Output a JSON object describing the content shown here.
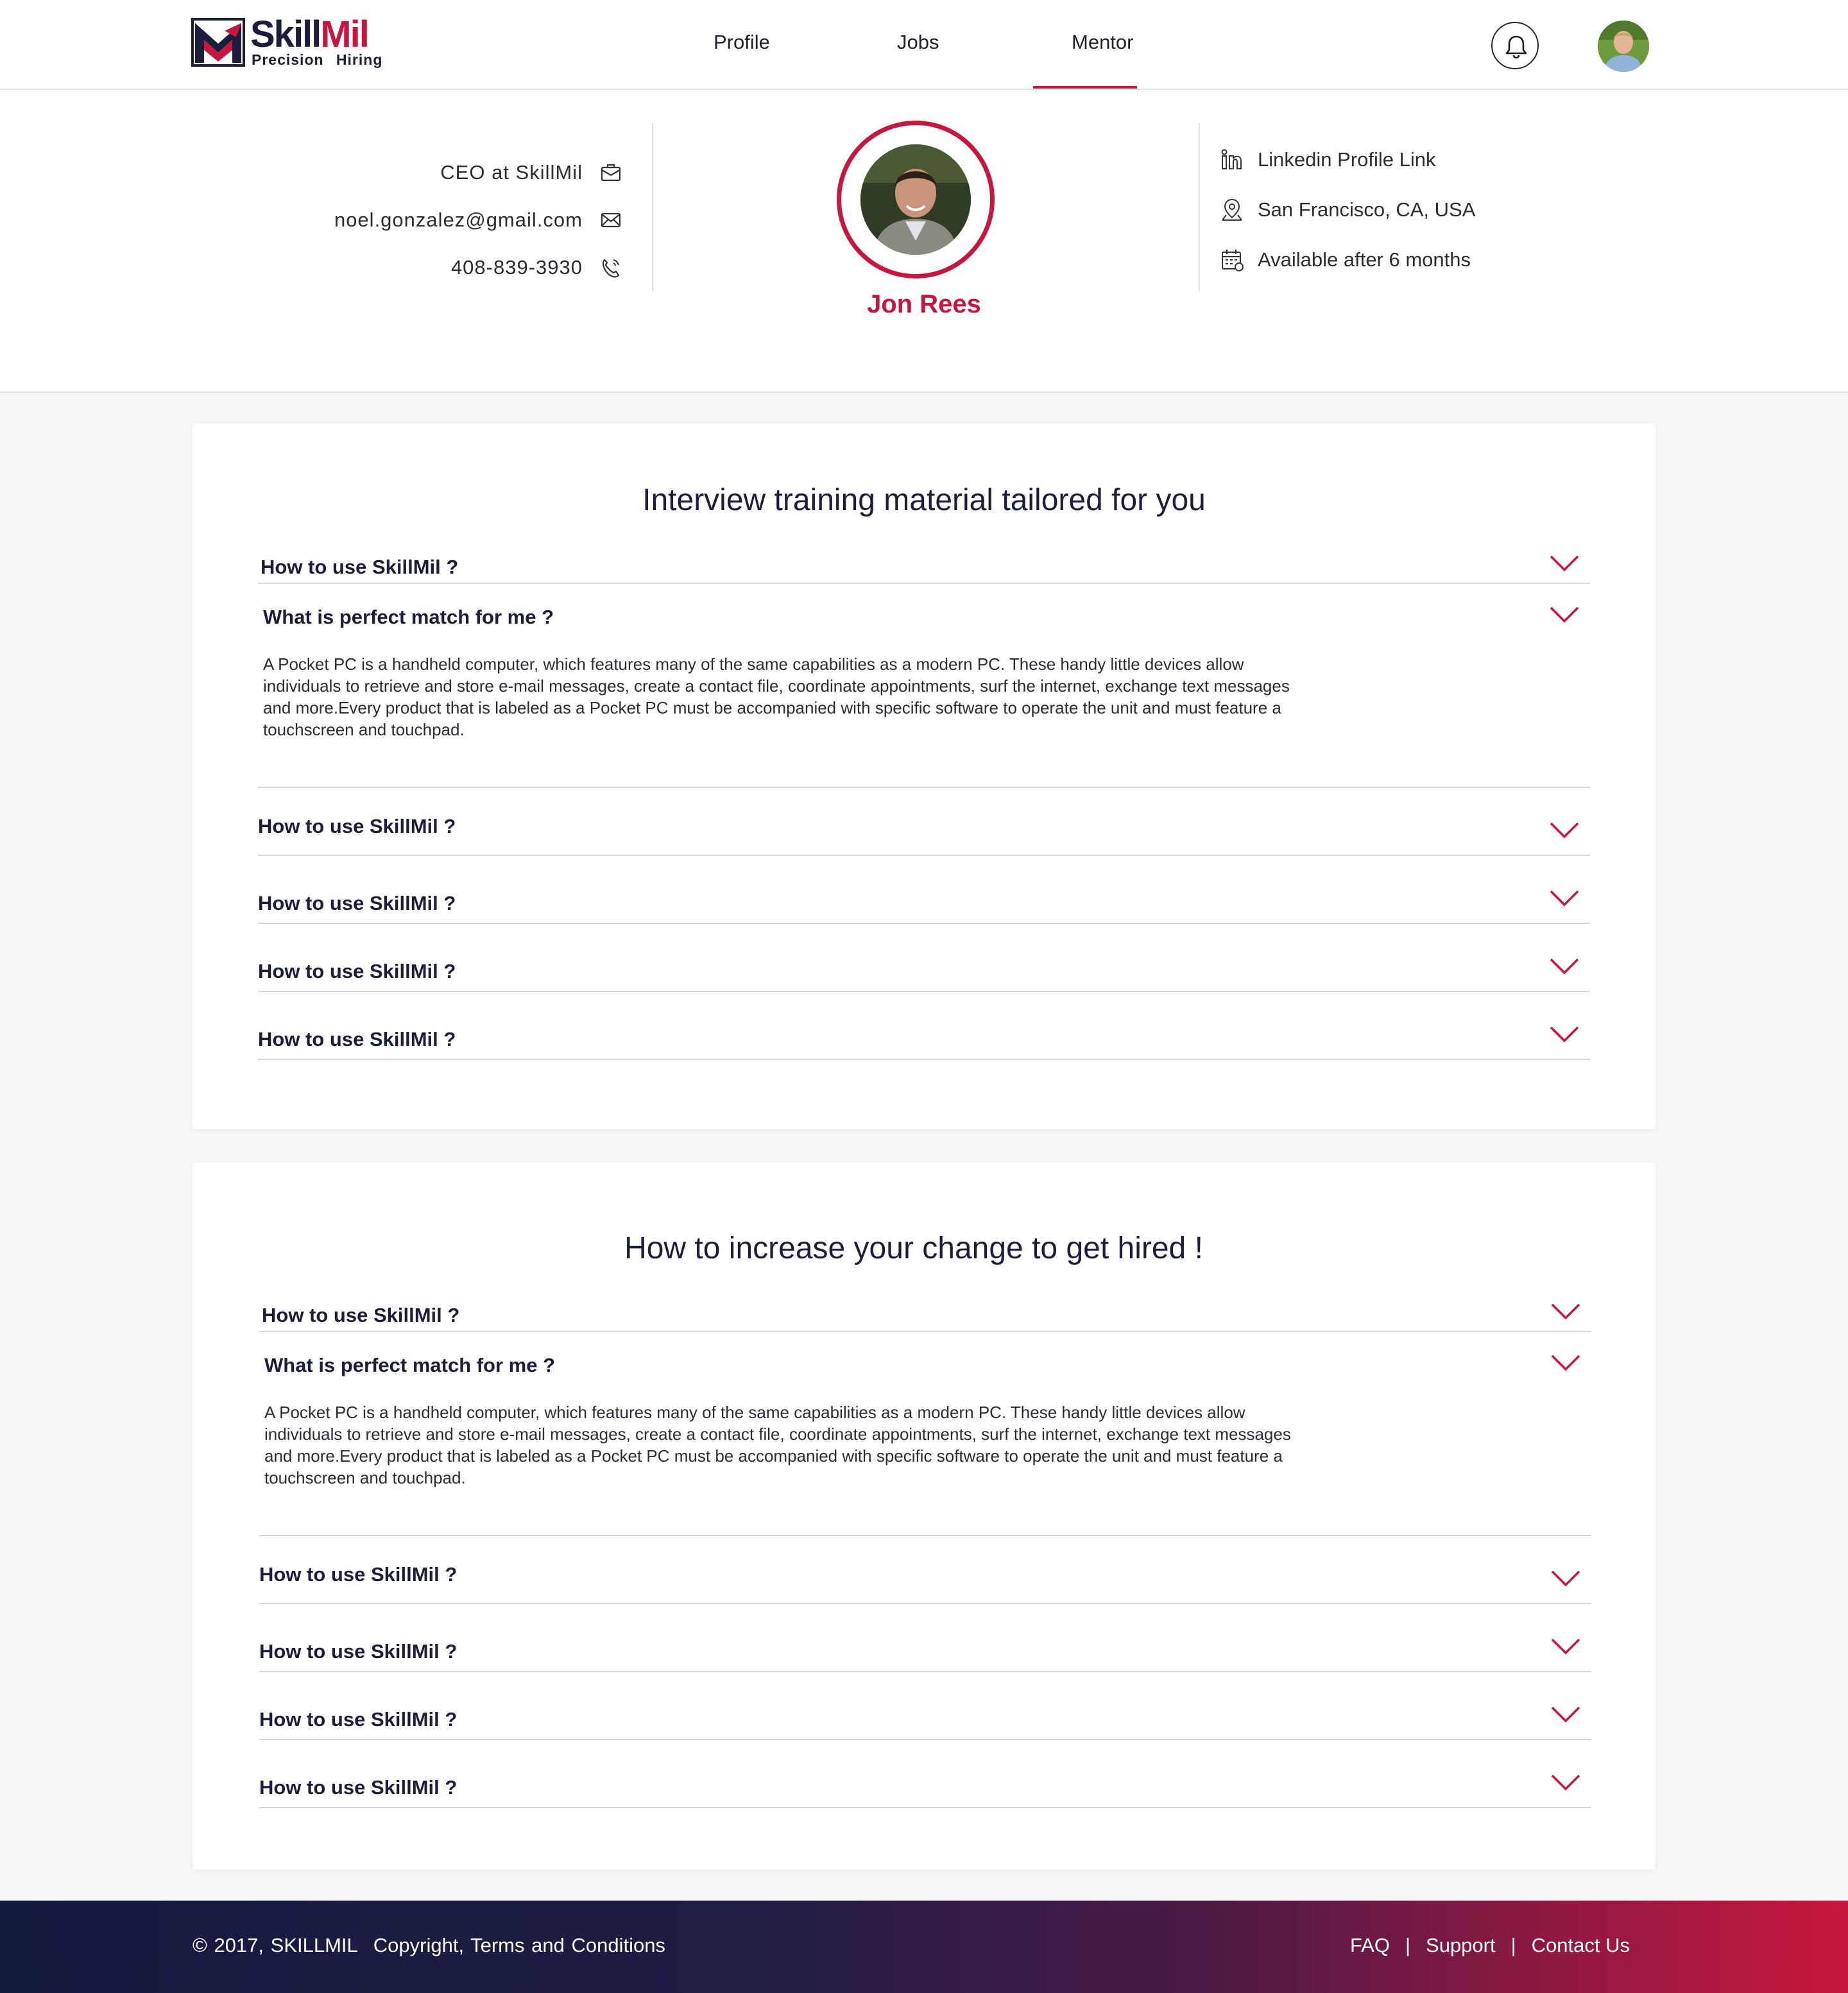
{
  "brand": {
    "name_part1": "Skill",
    "name_part2": "Mil",
    "tagline": "Precision Hiring",
    "colors": {
      "primary": "#1b1e3b",
      "accent": "#c8173f"
    }
  },
  "nav": {
    "items": [
      {
        "label": "Profile",
        "active": false
      },
      {
        "label": "Jobs",
        "active": false
      },
      {
        "label": "Mentor",
        "active": true
      }
    ],
    "icons": [
      "bell-icon",
      "user-avatar"
    ]
  },
  "profile": {
    "name": "Jon Rees",
    "title": "CEO at SkillMil",
    "email": "noel.gonzalez@gmail.com",
    "phone": "408-839-3930",
    "linkedin": "Linkedin Profile Link",
    "location": "San Francisco, CA, USA",
    "availability": "Available after 6 months"
  },
  "sections": [
    {
      "title": "Interview training material tailored for you",
      "items": [
        {
          "question": "How to use SkillMil ?",
          "expanded": false
        },
        {
          "question": "What is perfect match for me ?",
          "expanded": true,
          "answer": "A Pocket PC is a handheld computer, which features many of the same capabilities as a modern PC. These handy little devices allow individuals to retrieve and store e-mail messages, create a contact file, coordinate appointments, surf the internet, exchange text messages and more.Every product that is labeled as a Pocket PC must be accompanied with specific software to operate the unit and must feature a touchscreen and touchpad."
        },
        {
          "question": "How to use SkillMil ?",
          "expanded": false
        },
        {
          "question": "How to use SkillMil ?",
          "expanded": false
        },
        {
          "question": "How to use SkillMil ?",
          "expanded": false
        },
        {
          "question": "How to use SkillMil ?",
          "expanded": false
        }
      ]
    },
    {
      "title": "How to increase your change to get hired !",
      "items": [
        {
          "question": "How to use SkillMil ?",
          "expanded": false
        },
        {
          "question": "What is perfect match for me ?",
          "expanded": true,
          "answer": "A Pocket PC is a handheld computer, which features many of the same capabilities as a modern PC. These handy little devices allow individuals to retrieve and store e-mail messages, create a contact file, coordinate appointments, surf the internet, exchange text messages and more.Every product that is labeled as a Pocket PC must be accompanied with specific software to operate the unit and must feature a touchscreen and touchpad."
        },
        {
          "question": "How to use SkillMil ?",
          "expanded": false
        },
        {
          "question": "How to use SkillMil ?",
          "expanded": false
        },
        {
          "question": "How to use SkillMil ?",
          "expanded": false
        },
        {
          "question": "How to use SkillMil ?",
          "expanded": false
        }
      ]
    }
  ],
  "footer": {
    "copyright": "© 2017, SKILLMIL",
    "terms": "Copyright, Terms and Conditions",
    "links": [
      "FAQ",
      "Support",
      "Contact Us"
    ],
    "separator": "|"
  }
}
